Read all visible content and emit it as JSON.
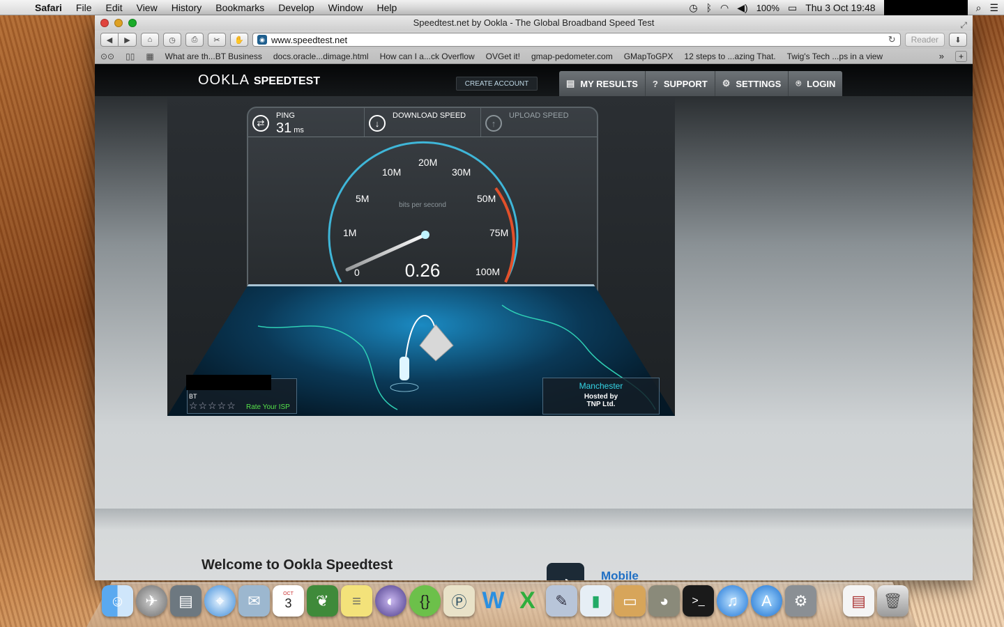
{
  "menubar": {
    "app": "Safari",
    "items": [
      "File",
      "Edit",
      "View",
      "History",
      "Bookmarks",
      "Develop",
      "Window",
      "Help"
    ],
    "battery": "100%",
    "clock": "Thu 3 Oct  19:48"
  },
  "window": {
    "title": "Speedtest.net by Ookla - The Global Broadband Speed Test",
    "url": "www.speedtest.net",
    "reader_label": "Reader"
  },
  "bookmarks": [
    "What are th...BT Business",
    "docs.oracle...dimage.html",
    "How can I a...ck Overflow",
    "OVGet it!",
    "gmap-pedometer.com",
    "GMapToGPX",
    "12 steps to ...azing That.",
    "Twig's Tech ...ps in a view"
  ],
  "site": {
    "logo_ookla": "OOKLA",
    "logo_speedtest": "SPEEDTEST",
    "create_account": "CREATE ACCOUNT",
    "nav": [
      "MY RESULTS",
      "SUPPORT",
      "SETTINGS",
      "LOGIN"
    ]
  },
  "gauge": {
    "ping_label": "PING",
    "ping_value": "31",
    "ping_unit": "ms",
    "download_label": "DOWNLOAD SPEED",
    "upload_label": "UPLOAD SPEED",
    "caption": "bits per second",
    "reading": "0.26",
    "ticks": [
      "0",
      "1M",
      "5M",
      "10M",
      "20M",
      "30M",
      "50M",
      "75M",
      "100M"
    ]
  },
  "isp": {
    "name": "BT",
    "rate_label": "Rate Your ISP",
    "stars": "☆☆☆☆☆"
  },
  "server": {
    "city": "Manchester",
    "hosted_line1": "Hosted by",
    "hosted_line2": "TNP Ltd."
  },
  "below": {
    "welcome": "Welcome to Ookla Speedtest",
    "mobile": "Mobile"
  },
  "dock": {
    "calendar_day": "3",
    "calendar_month": "OCT"
  }
}
